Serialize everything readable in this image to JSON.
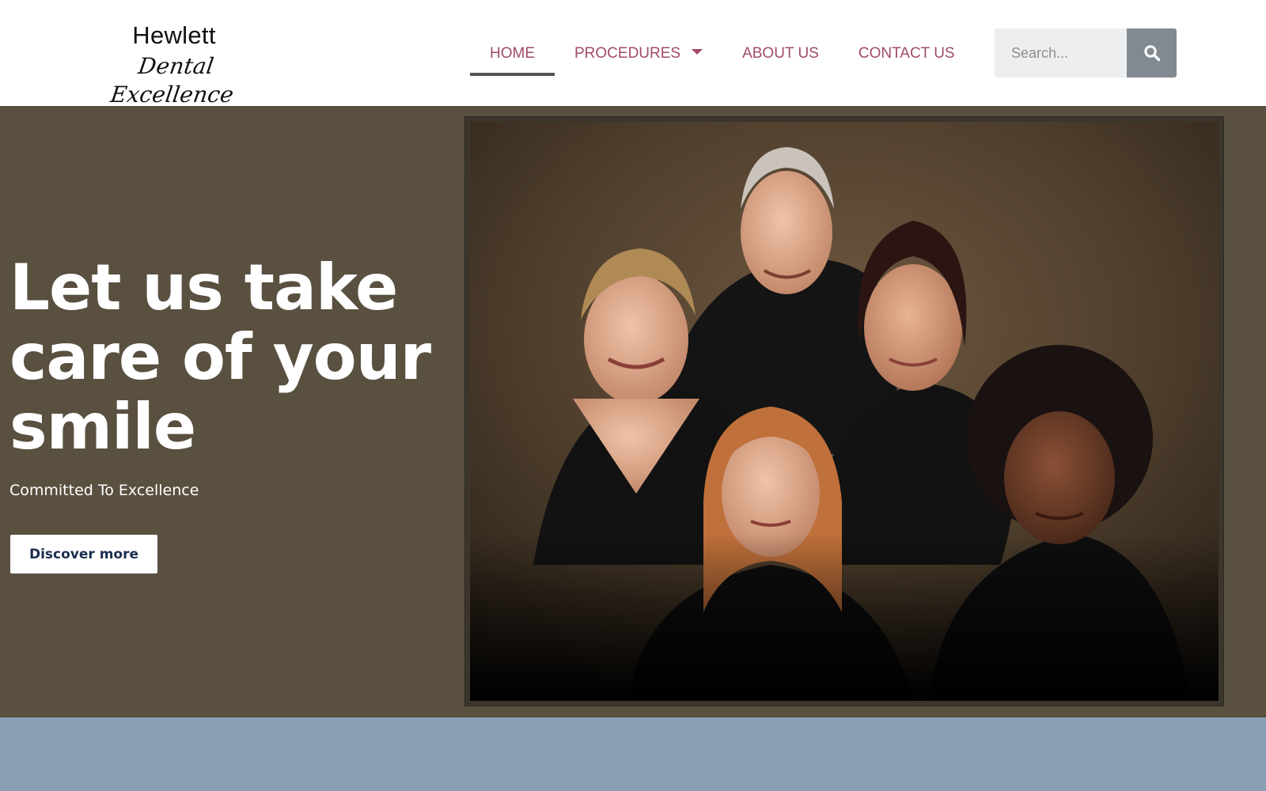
{
  "logo": {
    "line1": "Hewlett",
    "line2": "Dental Excellence"
  },
  "nav": {
    "items": [
      {
        "label": "HOME",
        "active": true
      },
      {
        "label": "PROCEDURES",
        "has_dropdown": true
      },
      {
        "label": "ABOUT US"
      },
      {
        "label": "CONTACT US"
      }
    ]
  },
  "search": {
    "placeholder": "Search...",
    "icon": "search-icon"
  },
  "hero": {
    "title": "Let us take care of your smile",
    "subtitle": "Committed To Excellence",
    "button_label": "Discover more",
    "image_description_icon": "team-photo"
  },
  "colors": {
    "nav_text": "#a04b6a",
    "nav_active_underline": "#545454",
    "hero_bg": "#595040",
    "lower_band_bg": "#8a9fb5",
    "search_button_bg": "#818a91",
    "button_text": "#1b2e4f"
  }
}
